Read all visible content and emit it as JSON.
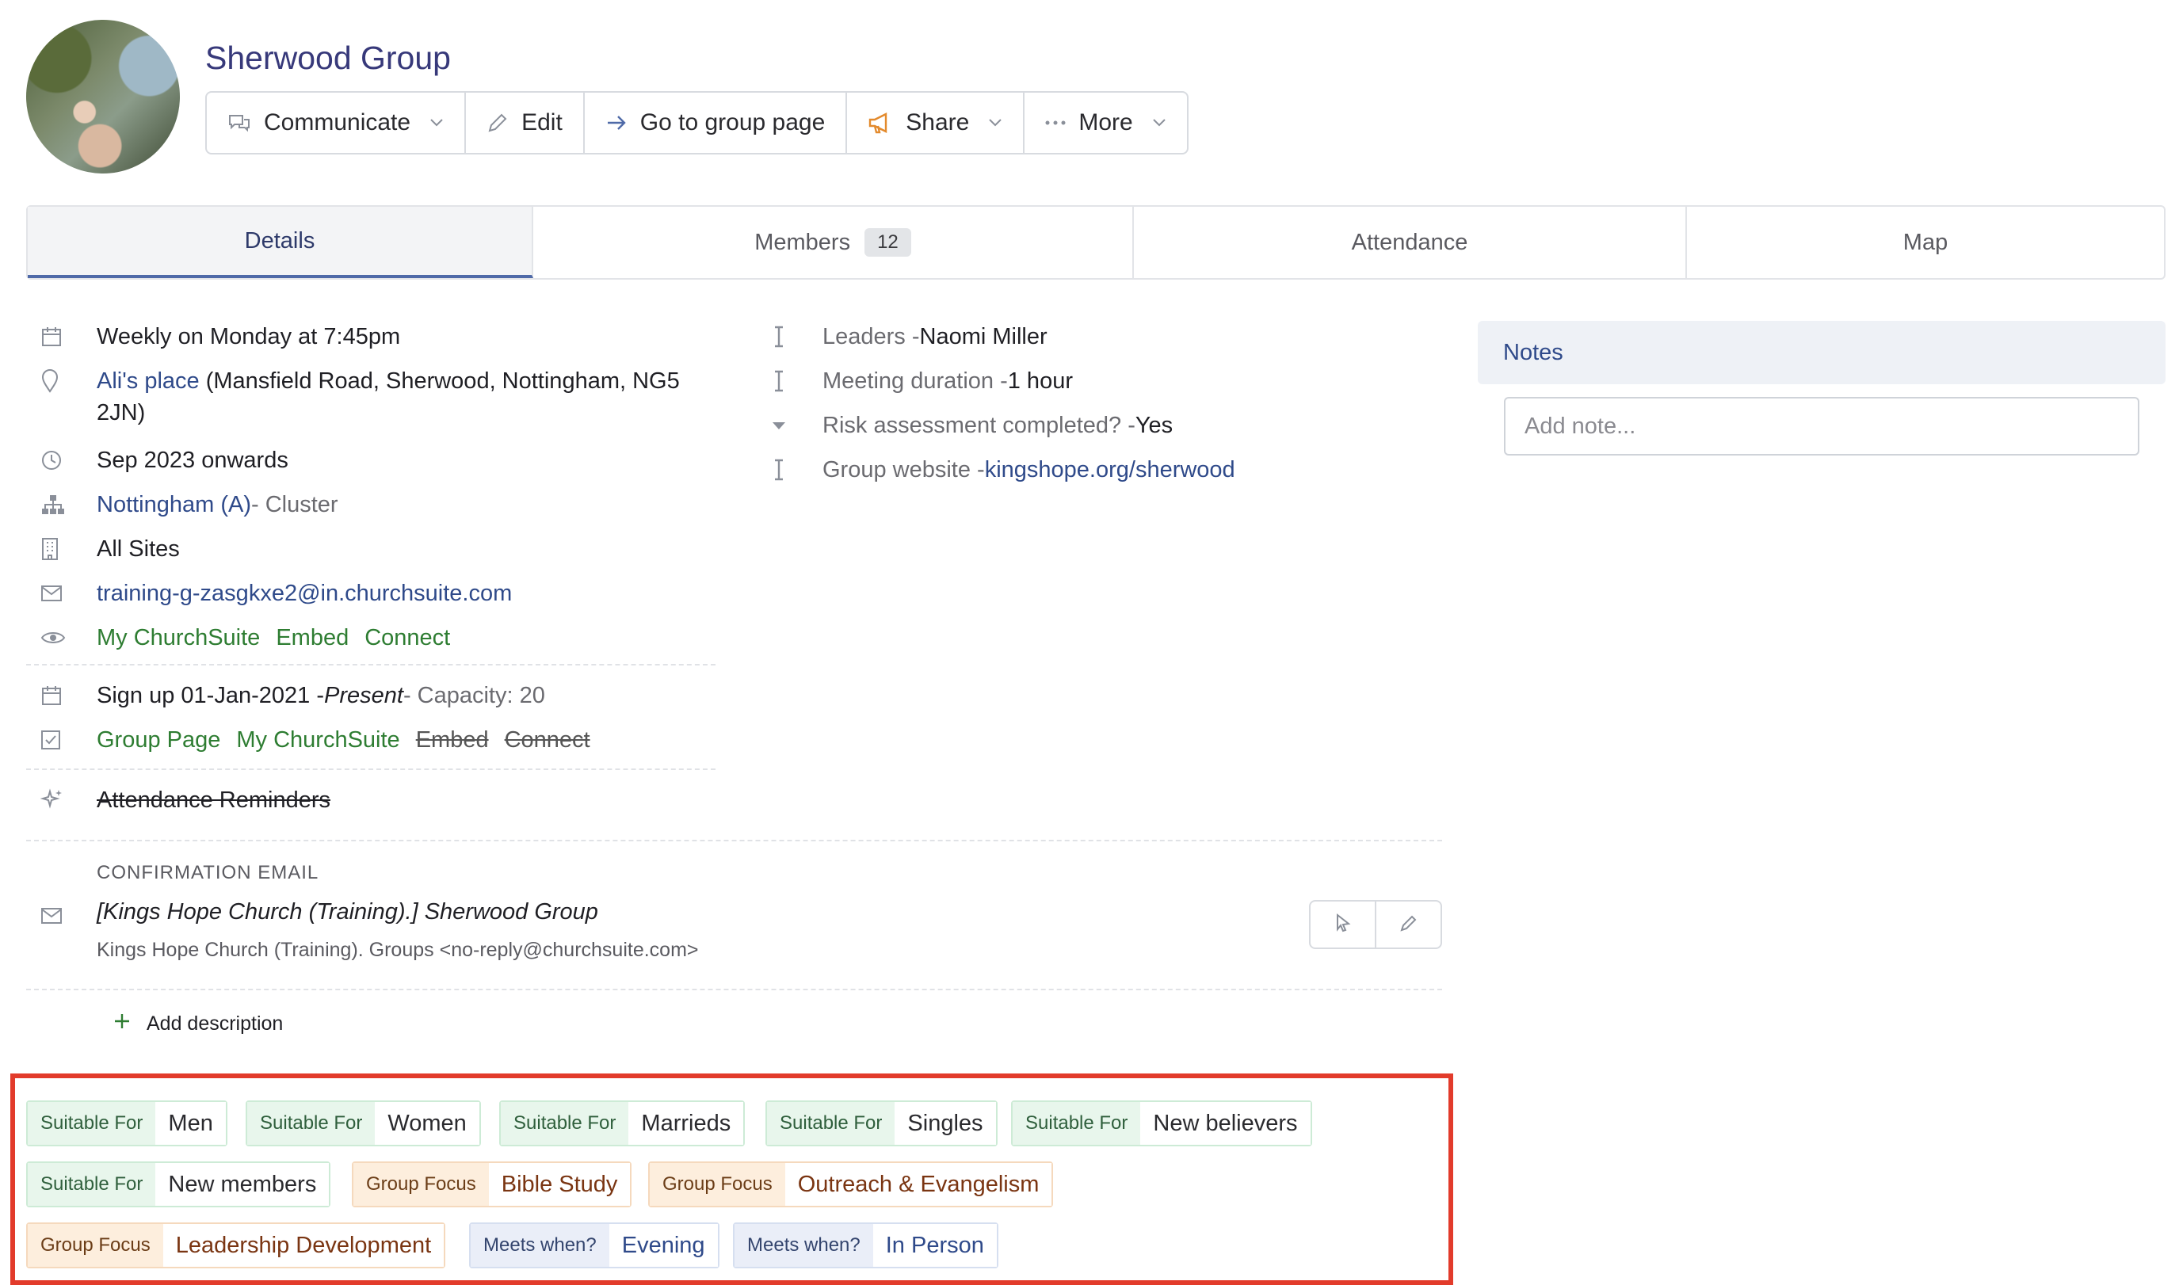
{
  "group": {
    "name": "Sherwood Group"
  },
  "toolbar": {
    "communicate": "Communicate",
    "edit": "Edit",
    "goto": "Go to group page",
    "share": "Share",
    "more": "More"
  },
  "tabs": [
    {
      "label": "Details",
      "active": true
    },
    {
      "label": "Members",
      "count": "12"
    },
    {
      "label": "Attendance"
    },
    {
      "label": "Map"
    }
  ],
  "details": {
    "schedule": "Weekly on Monday at 7:45pm",
    "location_name": "Ali's place",
    "location_address": " (Mansfield Road, Sherwood, Nottingham, NG5",
    "location_address_2": "2JN)",
    "start": "Sep 2023 onwards",
    "cluster_name": "Nottingham (A)",
    "cluster_suffix": " - Cluster",
    "sites": "All Sites",
    "email": "training-g-zasgkxe2@in.churchsuite.com",
    "visibility": [
      "My ChurchSuite",
      "Embed",
      "Connect"
    ],
    "signup_prefix": "Sign up 01-Jan-2021 - ",
    "signup_present": "Present",
    "signup_capacity": " - Capacity: 20",
    "signup_visible": [
      "Group Page",
      "My ChurchSuite"
    ],
    "signup_hidden": [
      "Embed",
      "Connect"
    ],
    "reminders": "Attendance Reminders"
  },
  "fields": [
    {
      "label": "Leaders - ",
      "value": "Naomi Miller"
    },
    {
      "label": "Meeting duration - ",
      "value": "1 hour"
    },
    {
      "label": "Risk assessment completed? - ",
      "value": "Yes"
    },
    {
      "label": "Group website - ",
      "value": "kingshope.org/sherwood"
    }
  ],
  "notes": {
    "title": "Notes",
    "placeholder": "Add note..."
  },
  "confirmation": {
    "label": "CONFIRMATION EMAIL",
    "subject": "[Kings Hope Church (Training).] Sherwood Group",
    "from": "Kings Hope Church (Training). Groups  <no-reply@churchsuite.com>"
  },
  "add_description": "Add description",
  "tags": [
    {
      "key": "Suitable For",
      "value": "Men",
      "kind": "suit"
    },
    {
      "key": "Suitable For",
      "value": "Women",
      "kind": "suit"
    },
    {
      "key": "Suitable For",
      "value": "Marrieds",
      "kind": "suit"
    },
    {
      "key": "Suitable For",
      "value": "Singles",
      "kind": "suit"
    },
    {
      "key": "Suitable For",
      "value": "New believers",
      "kind": "suit"
    },
    {
      "key": "Suitable For",
      "value": "New members",
      "kind": "suit"
    },
    {
      "key": "Group Focus",
      "value": "Bible Study",
      "kind": "focus"
    },
    {
      "key": "Group Focus",
      "value": "Outreach & Evangelism",
      "kind": "focus"
    },
    {
      "key": "Group Focus",
      "value": "Leadership Development",
      "kind": "focus"
    },
    {
      "key": "Meets when?",
      "value": "Evening",
      "kind": "meet"
    },
    {
      "key": "Meets when?",
      "value": "In Person",
      "kind": "meet"
    }
  ],
  "colors": {
    "accent": "#37397a",
    "link": "#2f4a8a",
    "green": "#2e7d32",
    "highlight": "#e23b2b"
  }
}
